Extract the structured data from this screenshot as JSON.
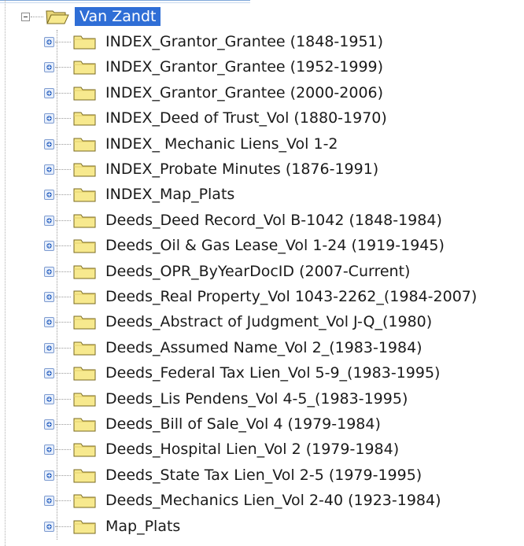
{
  "tree": {
    "root": {
      "label": "Van Zandt",
      "expanded": true,
      "selected": true
    },
    "items": [
      {
        "label": "INDEX_Grantor_Grantee (1848-1951)"
      },
      {
        "label": "INDEX_Grantor_Grantee (1952-1999)"
      },
      {
        "label": "INDEX_Grantor_Grantee (2000-2006)"
      },
      {
        "label": "INDEX_Deed of Trust_Vol (1880-1970)"
      },
      {
        "label": "INDEX_ Mechanic Liens_Vol 1-2"
      },
      {
        "label": "INDEX_Probate Minutes (1876-1991)"
      },
      {
        "label": "INDEX_Map_Plats"
      },
      {
        "label": "Deeds_Deed Record_Vol B-1042 (1848-1984)"
      },
      {
        "label": "Deeds_Oil & Gas Lease_Vol 1-24 (1919-1945)"
      },
      {
        "label": "Deeds_OPR_ByYearDocID (2007-Current)"
      },
      {
        "label": "Deeds_Real Property_Vol 1043-2262_(1984-2007)"
      },
      {
        "label": "Deeds_Abstract of Judgment_Vol J-Q_(1980)"
      },
      {
        "label": "Deeds_Assumed Name_Vol 2_(1983-1984)"
      },
      {
        "label": "Deeds_Federal Tax Lien_Vol 5-9_(1983-1995)"
      },
      {
        "label": "Deeds_Lis Pendens_Vol 4-5_(1983-1995)"
      },
      {
        "label": "Deeds_Bill of Sale_Vol 4 (1979-1984)"
      },
      {
        "label": "Deeds_Hospital Lien_Vol 2 (1979-1984)"
      },
      {
        "label": "Deeds_State Tax Lien_Vol 2-5 (1979-1995)"
      },
      {
        "label": "Deeds_Mechanics Lien_Vol 2-40 (1923-1984)"
      },
      {
        "label": "Map_Plats"
      }
    ]
  },
  "icons": {
    "expand": "plus-expander-icon",
    "collapse": "minus-collapse-icon",
    "folder": "folder-icon",
    "folder_open": "open-folder-icon"
  },
  "colors": {
    "selection_bg": "#2f6ed6",
    "selection_text": "#ffffff",
    "folder_fill": "#f7e98e",
    "folder_stroke": "#8a7a2a",
    "expander_blue": "#3b6fc7"
  }
}
